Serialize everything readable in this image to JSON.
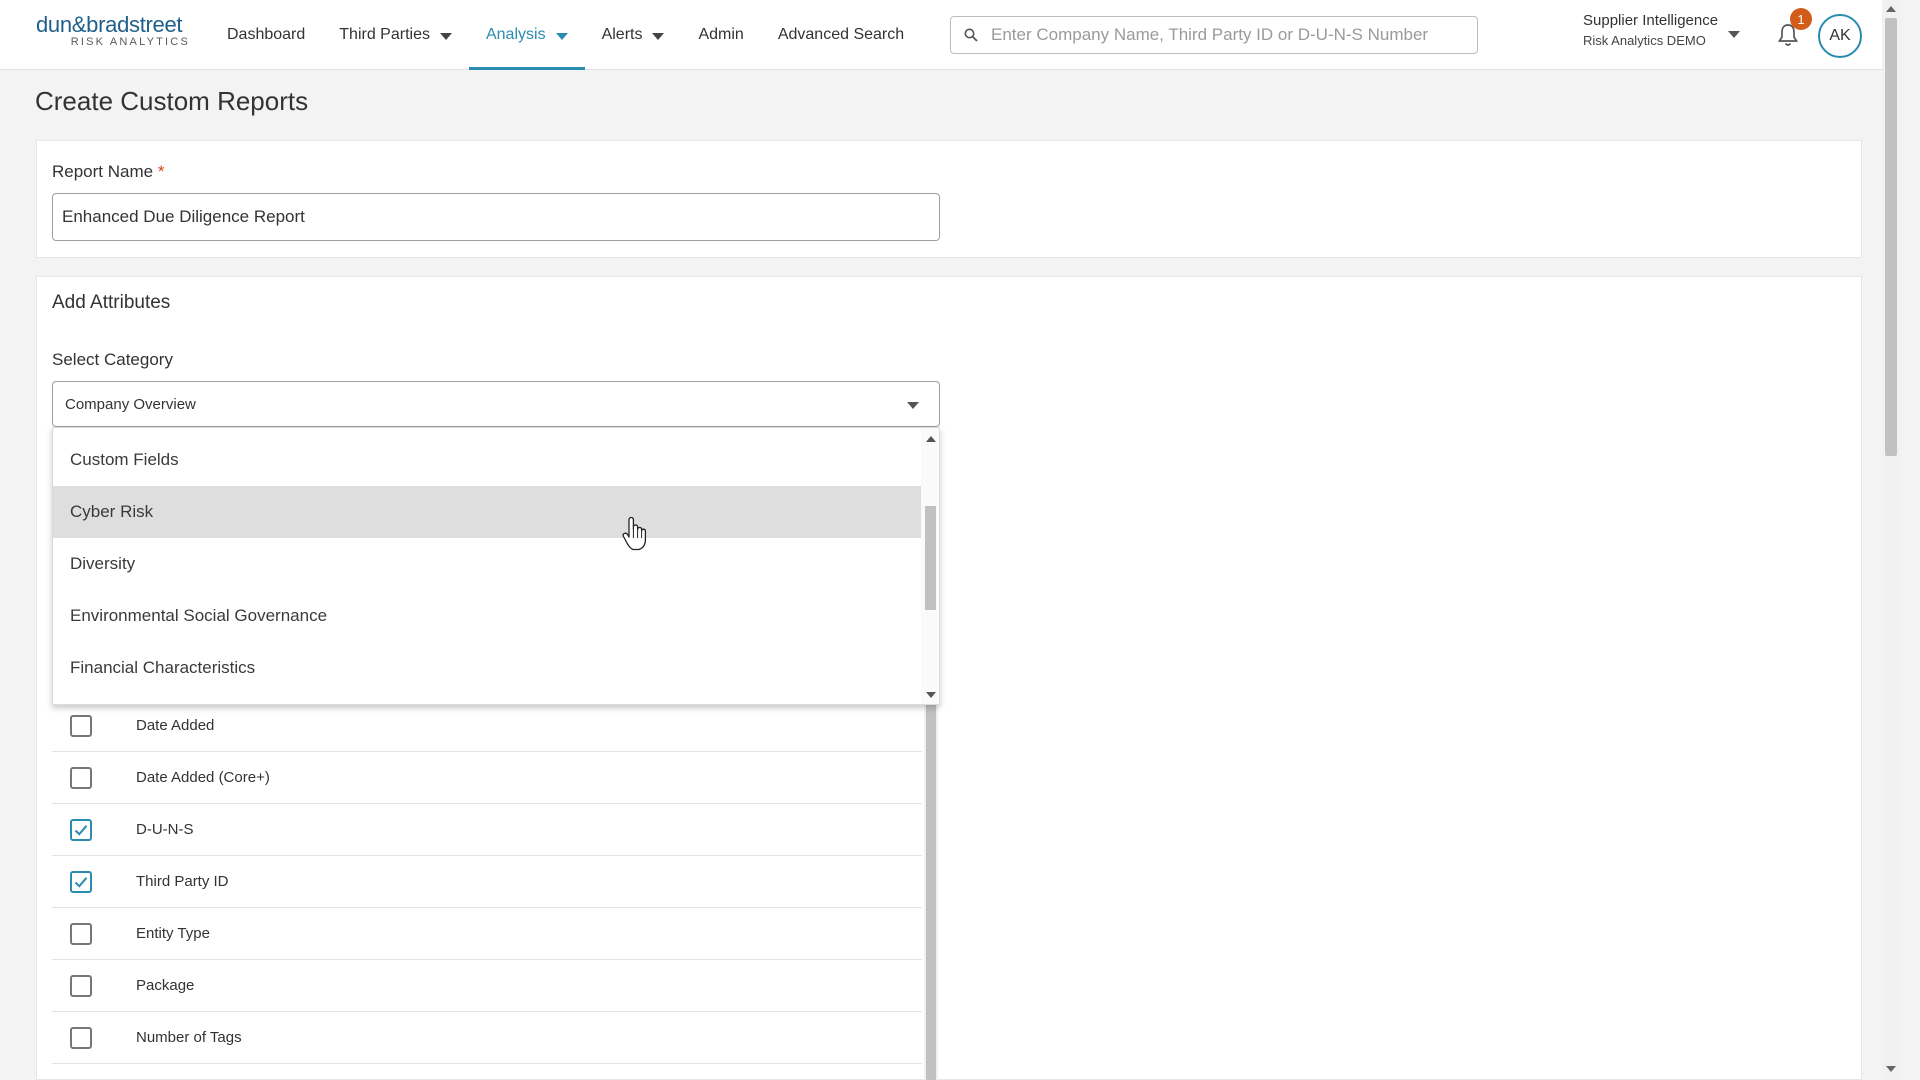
{
  "header": {
    "logo_main": "dun&bradstreet",
    "logo_sub": "RISK ANALYTICS",
    "nav": [
      {
        "label": "Dashboard",
        "dropdown": false,
        "active": false
      },
      {
        "label": "Third Parties",
        "dropdown": true,
        "active": false
      },
      {
        "label": "Analysis",
        "dropdown": true,
        "active": true
      },
      {
        "label": "Alerts",
        "dropdown": true,
        "active": false
      },
      {
        "label": "Admin",
        "dropdown": false,
        "active": false
      },
      {
        "label": "Advanced Search",
        "dropdown": false,
        "active": false
      }
    ],
    "search_placeholder": "Enter Company Name, Third Party ID or D-U-N-S Number",
    "org_name": "Supplier Intelligence",
    "org_sub": "Risk Analytics DEMO",
    "notification_count": "1",
    "avatar_initials": "AK",
    "icons": [
      "search-icon",
      "bell-icon",
      "chevron-down-icon"
    ]
  },
  "page": {
    "title": "Create Custom Reports",
    "report_name_label": "Report Name",
    "required_marker": "*",
    "report_name_value": "Enhanced Due Diligence Report",
    "add_attributes_title": "Add Attributes",
    "select_category_label": "Select Category",
    "selected_category": "Company Overview"
  },
  "dropdown_options": [
    {
      "label": "Custom Fields",
      "hovered": false
    },
    {
      "label": "Cyber Risk",
      "hovered": true
    },
    {
      "label": "Diversity",
      "hovered": false
    },
    {
      "label": "Environmental Social Governance",
      "hovered": false
    },
    {
      "label": "Financial Characteristics",
      "hovered": false
    }
  ],
  "attributes": [
    {
      "label": "Date Added",
      "checked": false
    },
    {
      "label": "Date Added (Core+)",
      "checked": false
    },
    {
      "label": "D-U-N-S",
      "checked": true
    },
    {
      "label": "Third Party ID",
      "checked": true
    },
    {
      "label": "Entity Type",
      "checked": false
    },
    {
      "label": "Package",
      "checked": false
    },
    {
      "label": "Number of Tags",
      "checked": false
    }
  ],
  "colors": {
    "accent": "#2b8bb0",
    "brand": "#1f5f8b",
    "badge": "#d25c19",
    "required": "#d0481a",
    "hover_row": "#dedede"
  }
}
